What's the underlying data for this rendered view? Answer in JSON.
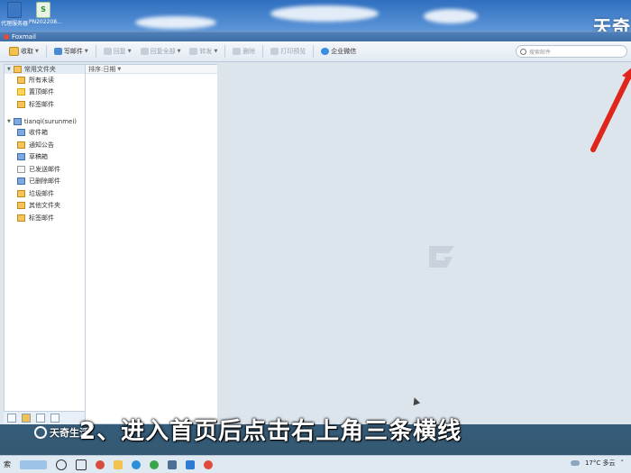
{
  "desktop": {
    "icons": [
      {
        "label": "代理服务器",
        "icon": "app-icon"
      },
      {
        "label": "PN202208...",
        "icon": "document-icon"
      }
    ],
    "watermark_top": "天奇"
  },
  "window": {
    "title": "Foxmail",
    "toolbar": {
      "receive": "收取",
      "compose": "写邮件",
      "reply": "回复",
      "reply_all": "回复全部",
      "forward": "转发",
      "delete": "删除",
      "print_preview": "打印预览",
      "enterprise_wechat": "企业微信",
      "search_placeholder": "搜索邮件"
    },
    "folders": {
      "common_group": "常用文件夹",
      "common_items": [
        "所有未读",
        "置顶邮件",
        "标签邮件"
      ],
      "account": "tianqi(surunmei)",
      "account_items": [
        "收件箱",
        "通知公告",
        "草稿箱",
        "已发送邮件",
        "已删除邮件",
        "垃圾邮件",
        "其他文件夹",
        "标签邮件"
      ]
    },
    "maillist": {
      "sort_label": "排序:日期"
    }
  },
  "overlay": {
    "subtitle": "2、进入首页后点击右上角三条横线",
    "watermark_bottom": "天奇生活"
  },
  "taskbar": {
    "left_text": "索",
    "weather": "17°C  多云"
  },
  "colors": {
    "annotation_arrow": "#e0261c",
    "title_bar": "#4e7fb8"
  }
}
